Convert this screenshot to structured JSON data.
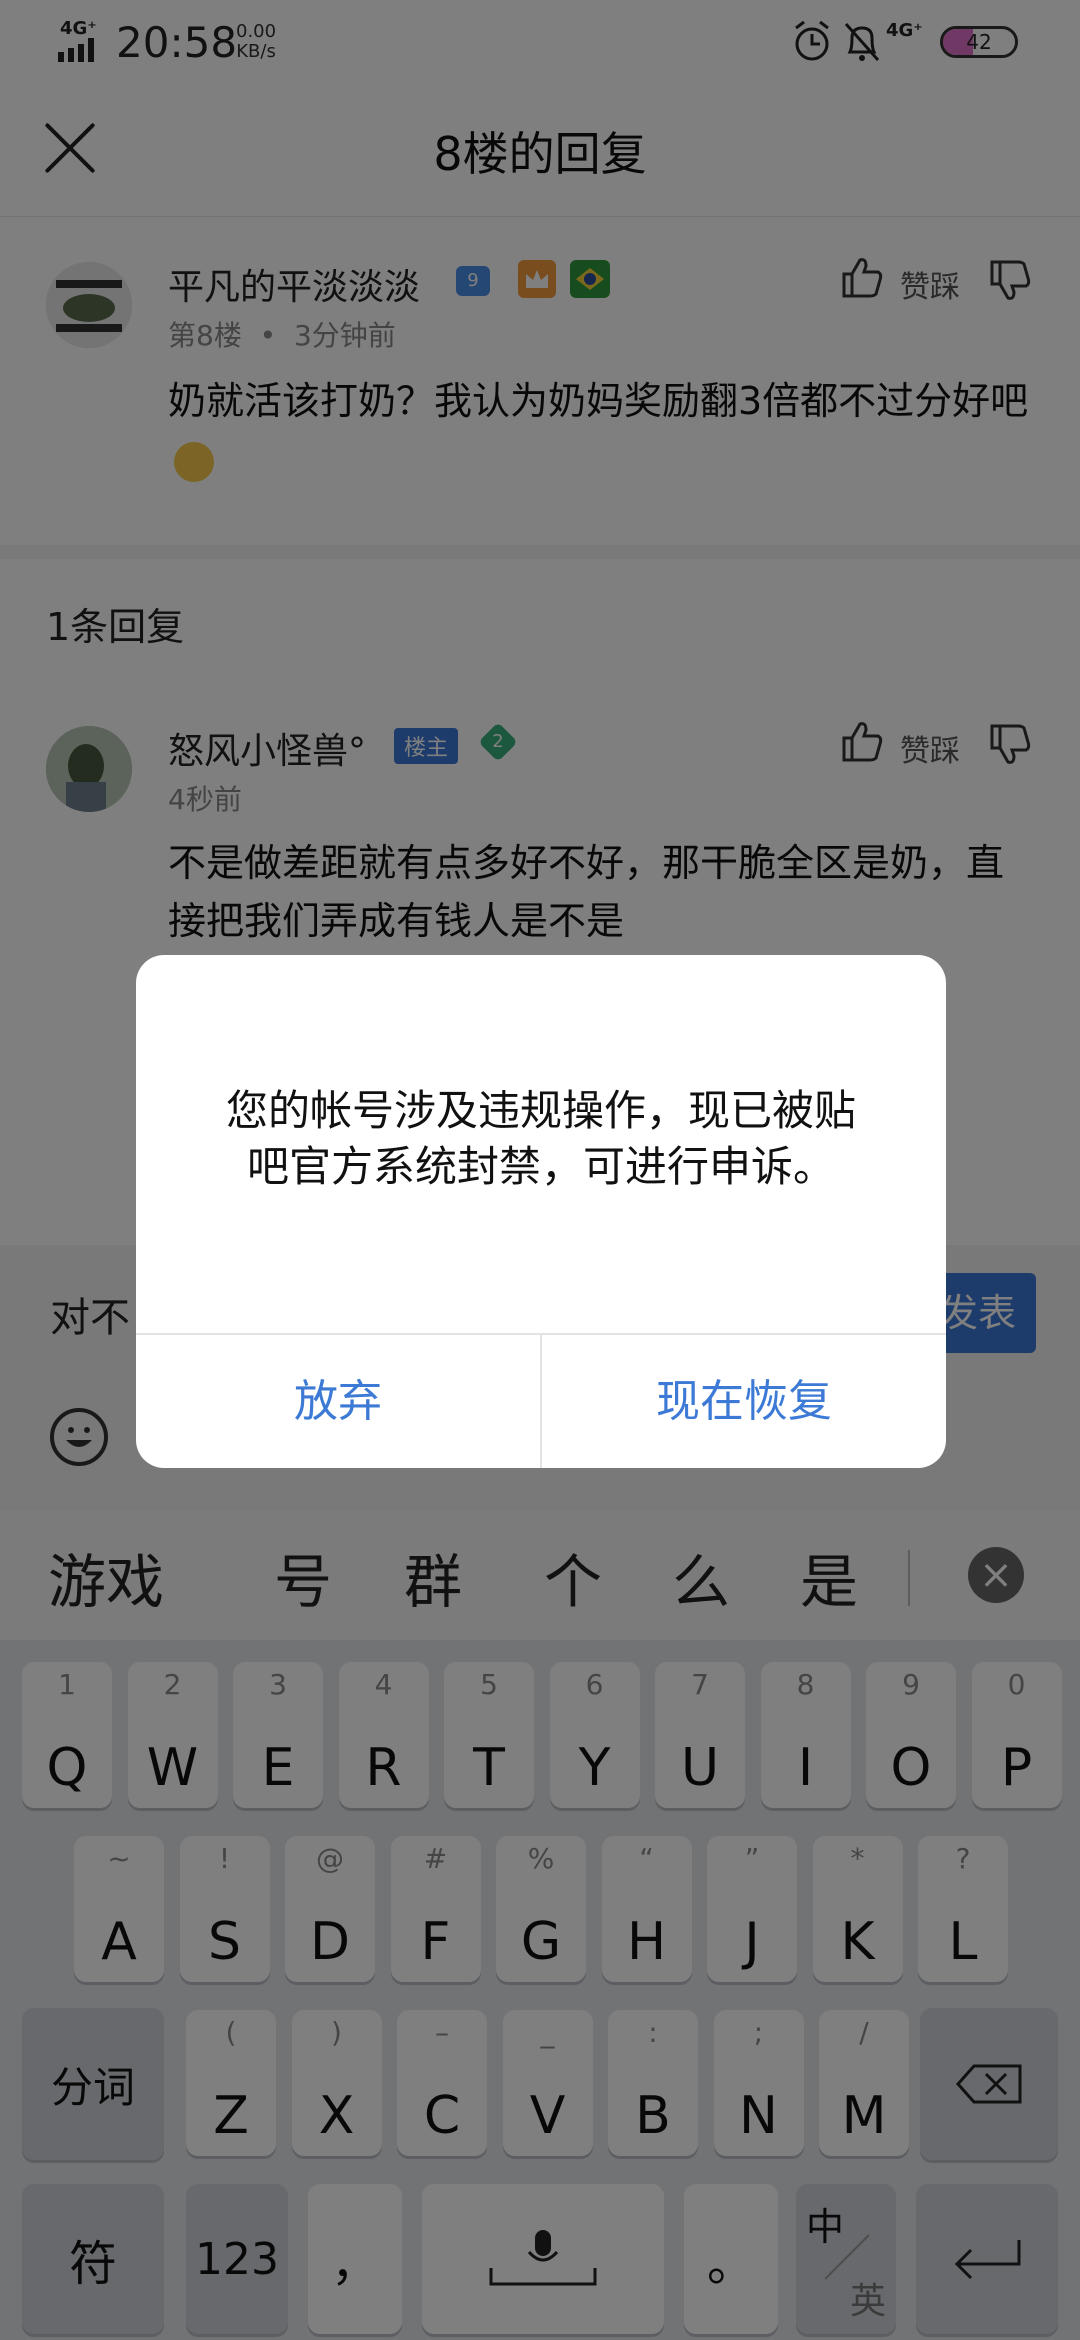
{
  "status_bar": {
    "network": "4G⁺",
    "time": "20:58",
    "speed_value": "0.00",
    "speed_unit": "KB/s",
    "network_right": "4G⁺",
    "battery": "42",
    "battery_level": 0.42
  },
  "header": {
    "title": "8楼的回复"
  },
  "main_post": {
    "username": "平凡的平淡淡淡",
    "level": "9",
    "floor": "第8楼",
    "dot": "•",
    "time": "3分钟前",
    "content": "奶就活该打奶？我认为奶妈奖励翻3倍都不过分好吧",
    "like_label": "赞踩"
  },
  "replies_header": "1条回复",
  "reply": {
    "username": "怒风小怪兽°",
    "host_badge": "楼主",
    "level": "2",
    "time": "4秒前",
    "content": "不是做差距就有点多好不好，那干脆全区是奶，直接把我们弄成有钱人是不是",
    "like_label": "赞踩"
  },
  "input": {
    "text": "对不",
    "publish": "发表"
  },
  "candidates": [
    "游戏",
    "号",
    "群",
    "个",
    "么",
    "是"
  ],
  "keyboard": {
    "row1": [
      {
        "sub": "1",
        "main": "Q"
      },
      {
        "sub": "2",
        "main": "W"
      },
      {
        "sub": "3",
        "main": "E"
      },
      {
        "sub": "4",
        "main": "R"
      },
      {
        "sub": "5",
        "main": "T"
      },
      {
        "sub": "6",
        "main": "Y"
      },
      {
        "sub": "7",
        "main": "U"
      },
      {
        "sub": "8",
        "main": "I"
      },
      {
        "sub": "9",
        "main": "O"
      },
      {
        "sub": "0",
        "main": "P"
      }
    ],
    "row2": [
      {
        "sub": "~",
        "main": "A"
      },
      {
        "sub": "!",
        "main": "S"
      },
      {
        "sub": "@",
        "main": "D"
      },
      {
        "sub": "#",
        "main": "F"
      },
      {
        "sub": "%",
        "main": "G"
      },
      {
        "sub": "“",
        "main": "H"
      },
      {
        "sub": "”",
        "main": "J"
      },
      {
        "sub": "*",
        "main": "K"
      },
      {
        "sub": "?",
        "main": "L"
      }
    ],
    "row3_left": "分词",
    "row3": [
      {
        "sub": "(",
        "main": "Z"
      },
      {
        "sub": ")",
        "main": "X"
      },
      {
        "sub": "–",
        "main": "C"
      },
      {
        "sub": "_",
        "main": "V"
      },
      {
        "sub": ":",
        "main": "B"
      },
      {
        "sub": ";",
        "main": "N"
      },
      {
        "sub": "/",
        "main": "M"
      }
    ],
    "symbol": "符",
    "num": "123",
    "comma": "，",
    "period": "。",
    "lang_top": "中",
    "lang_bottom": "英"
  },
  "dialog": {
    "message_line1": "您的帐号涉及违规操作，现已被贴",
    "message_line2": "吧官方系统封禁，可进行申诉。",
    "cancel": "放弃",
    "confirm": "现在恢复"
  }
}
